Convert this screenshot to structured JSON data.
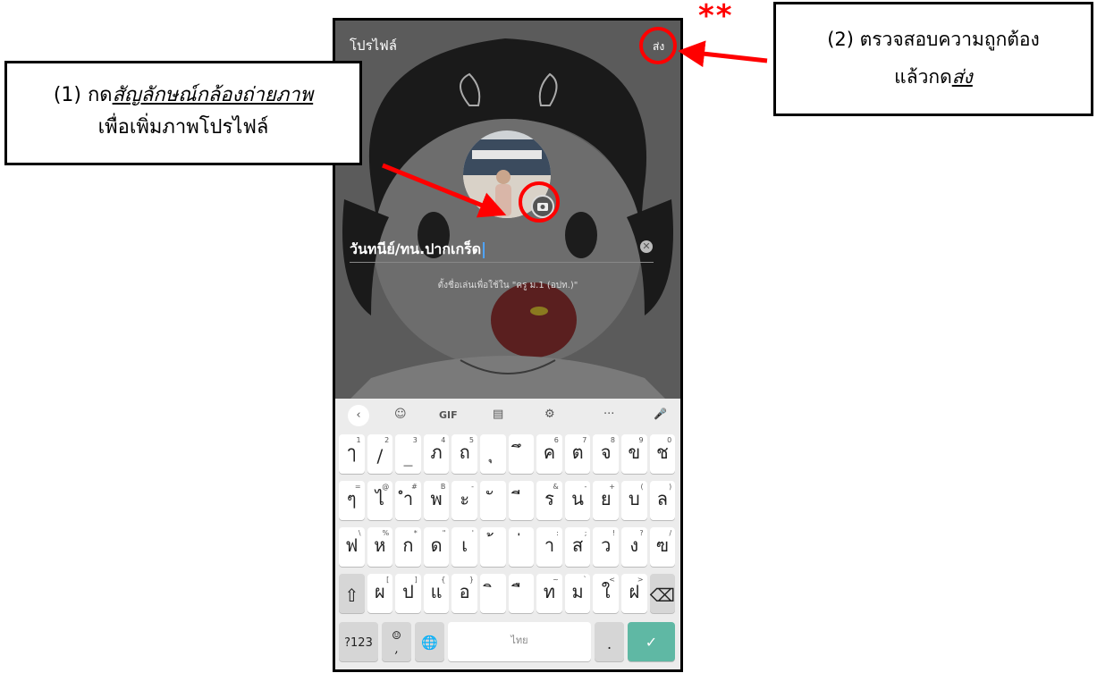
{
  "header": {
    "title": "โปรไฟล์",
    "send_label": "ส่ง"
  },
  "profile": {
    "name_value": "วันทนีย์/ทน.ปากเกร็ด",
    "hint": "ตั้งชื่อเล่นเพื่อใช้ใน \"ครู ม.1 (อปท.)\""
  },
  "keyboard": {
    "tools": [
      "‹",
      "☺",
      "GIF",
      "▤",
      "⚙",
      "···",
      "🎤"
    ],
    "row1": [
      [
        "ๅ",
        "1"
      ],
      [
        "/",
        "2"
      ],
      [
        "_",
        "3"
      ],
      [
        "ภ",
        "4"
      ],
      [
        "ถ",
        "5"
      ],
      [
        "ุ",
        ""
      ],
      [
        "ึ",
        ""
      ],
      [
        "ค",
        "6"
      ],
      [
        "ต",
        "7"
      ],
      [
        "จ",
        "8"
      ],
      [
        "ข",
        "9"
      ],
      [
        "ช",
        "0"
      ]
    ],
    "row2": [
      [
        "ๆ",
        "="
      ],
      [
        "ไ",
        "@"
      ],
      [
        "ำ",
        "#"
      ],
      [
        "พ",
        "B"
      ],
      [
        "ะ",
        "-"
      ],
      [
        "ั",
        ""
      ],
      [
        "ี",
        ""
      ],
      [
        "ร",
        "&"
      ],
      [
        "น",
        "-"
      ],
      [
        "ย",
        "+"
      ],
      [
        "บ",
        "("
      ],
      [
        "ล",
        ")"
      ]
    ],
    "row3": [
      [
        "ฟ",
        "\\"
      ],
      [
        "ห",
        "%"
      ],
      [
        "ก",
        "*"
      ],
      [
        "ด",
        "\""
      ],
      [
        "เ",
        "'"
      ],
      [
        "้",
        ""
      ],
      [
        "่",
        ""
      ],
      [
        "า",
        ":"
      ],
      [
        "ส",
        ";"
      ],
      [
        "ว",
        "!"
      ],
      [
        "ง",
        "?"
      ],
      [
        "ฃ",
        "/"
      ]
    ],
    "row4": [
      [
        "⇧",
        ""
      ],
      [
        "ผ",
        "["
      ],
      [
        "ป",
        "]"
      ],
      [
        "แ",
        "{"
      ],
      [
        "อ",
        "}"
      ],
      [
        "ิ",
        ""
      ],
      [
        "ื",
        ""
      ],
      [
        "ท",
        "~"
      ],
      [
        "ม",
        "`"
      ],
      [
        "ใ",
        "<"
      ],
      [
        "ฝ",
        ">"
      ],
      [
        "⌫",
        ""
      ]
    ],
    "sym_label": "?123",
    "emoji_label": "☺",
    "comma_label": ",",
    "globe_label": "🌐",
    "space_label": "ไทย",
    "period_label": ".",
    "enter_label": "✓"
  },
  "annotations": {
    "stars": "**",
    "left_prefix": "(1) กด",
    "left_link": "สัญลักษณ์กล้องถ่ายภาพ",
    "left_line2": "เพื่อเพิ่มภาพโปรไฟล์",
    "right_line1": "(2) ตรวจสอบความถูกต้อง",
    "right_prefix": "แล้วกด",
    "right_link": "ส่ง",
    "color": "#ff0000"
  }
}
